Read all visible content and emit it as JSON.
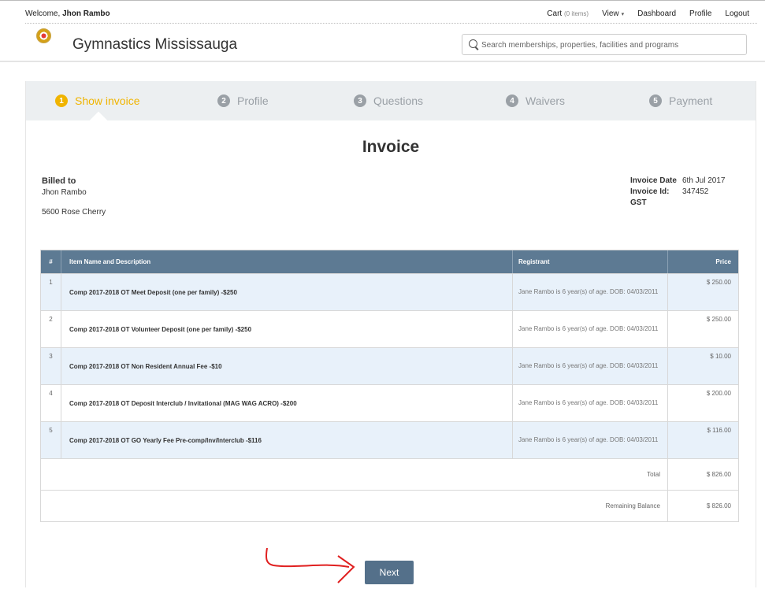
{
  "topbar": {
    "welcome_prefix": "Welcome,",
    "user_name": "Jhon Rambo",
    "cart_label": "Cart",
    "cart_count": "(0 items)",
    "view_label": "View",
    "dashboard_label": "Dashboard",
    "profile_label": "Profile",
    "logout_label": "Logout"
  },
  "header": {
    "site_title": "Gymnastics Mississauga",
    "search_placeholder": "Search memberships, properties, facilities and programs"
  },
  "steps": [
    {
      "num": "1",
      "label": "Show invoice",
      "active": true
    },
    {
      "num": "2",
      "label": "Profile"
    },
    {
      "num": "3",
      "label": "Questions"
    },
    {
      "num": "4",
      "label": "Waivers"
    },
    {
      "num": "5",
      "label": "Payment"
    }
  ],
  "invoice": {
    "title": "Invoice",
    "billed_label": "Billed to",
    "billed_name": "Jhon Rambo",
    "billed_address": "5600 Rose Cherry",
    "date_label": "Invoice Date",
    "date_value": "6th Jul 2017",
    "id_label": "Invoice Id:",
    "id_value": "347452",
    "gst_label": "GST"
  },
  "table": {
    "headers": [
      "#",
      "Item Name and Description",
      "Registrant",
      "Price"
    ],
    "rows": [
      {
        "num": "1",
        "item": "Comp 2017-2018 OT Meet Deposit (one per family) -$250",
        "registrant": "Jane Rambo is 6 year(s) of age. DOB: 04/03/2011",
        "price": "$ 250.00"
      },
      {
        "num": "2",
        "item": "Comp 2017-2018 OT Volunteer Deposit (one per family) -$250",
        "registrant": "Jane Rambo is 6 year(s) of age. DOB: 04/03/2011",
        "price": "$ 250.00"
      },
      {
        "num": "3",
        "item": "Comp 2017-2018 OT Non Resident Annual Fee -$10",
        "registrant": "Jane Rambo is 6 year(s) of age. DOB: 04/03/2011",
        "price": "$ 10.00"
      },
      {
        "num": "4",
        "item": "Comp 2017-2018 OT Deposit Interclub / Invitational (MAG WAG ACRO) -$200",
        "registrant": "Jane Rambo is 6 year(s) of age. DOB: 04/03/2011",
        "price": "$ 200.00"
      },
      {
        "num": "5",
        "item": "Comp 2017-2018 OT GO Yearly Fee Pre-comp/Inv/Interclub -$116",
        "registrant": "Jane Rambo is 6 year(s) of age. DOB: 04/03/2011",
        "price": "$ 116.00"
      }
    ],
    "total_label": "Total",
    "total_value": "$ 826.00",
    "balance_label": "Remaining Balance",
    "balance_value": "$ 826.00"
  },
  "actions": {
    "next_label": "Next"
  },
  "colors": {
    "accent": "#f0b400",
    "table_header": "#5d7a93",
    "row_shade": "#e8f1fa",
    "button": "#54708a",
    "annotation_arrow": "#e02020"
  }
}
